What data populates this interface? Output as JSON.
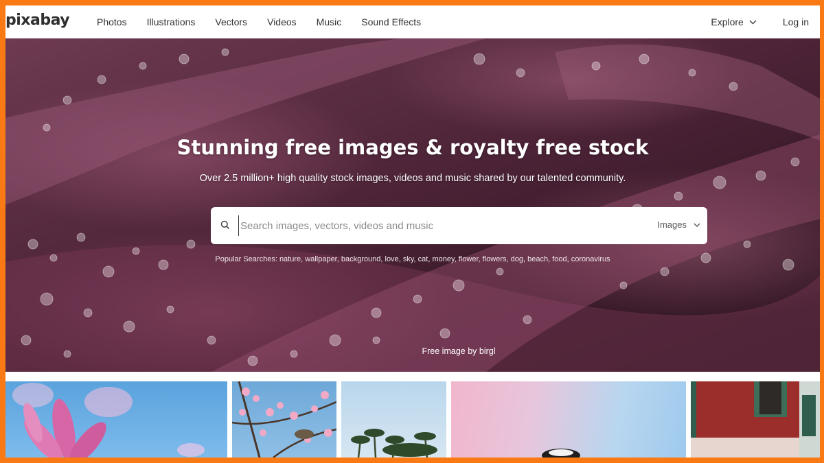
{
  "nav": {
    "logo": "pixabay",
    "links": [
      "Photos",
      "Illustrations",
      "Vectors",
      "Videos",
      "Music",
      "Sound Effects"
    ],
    "explore": "Explore",
    "login": "Log in"
  },
  "hero": {
    "title": "Stunning free images & royalty free stock",
    "subtitle": "Over 2.5 million+ high quality stock images, videos and music shared by our talented community.",
    "search": {
      "placeholder": "Search images, vectors, videos and music",
      "type": "Images"
    },
    "popular_label": "Popular Searches:",
    "popular": [
      "nature",
      "wallpaper",
      "background",
      "love",
      "sky",
      "cat",
      "money",
      "flower",
      "flowers",
      "dog",
      "beach",
      "food",
      "coronavirus"
    ],
    "credit": "Free image by birgl"
  },
  "thumbnails": [
    {
      "name": "pink-flower-thumb"
    },
    {
      "name": "bird-blossom-thumb"
    },
    {
      "name": "palm-trees-thumb"
    },
    {
      "name": "pastel-sky-thumb"
    },
    {
      "name": "red-building-thumb"
    }
  ],
  "colors": {
    "border": "#f97a14",
    "hero_base": "#4e2438"
  }
}
